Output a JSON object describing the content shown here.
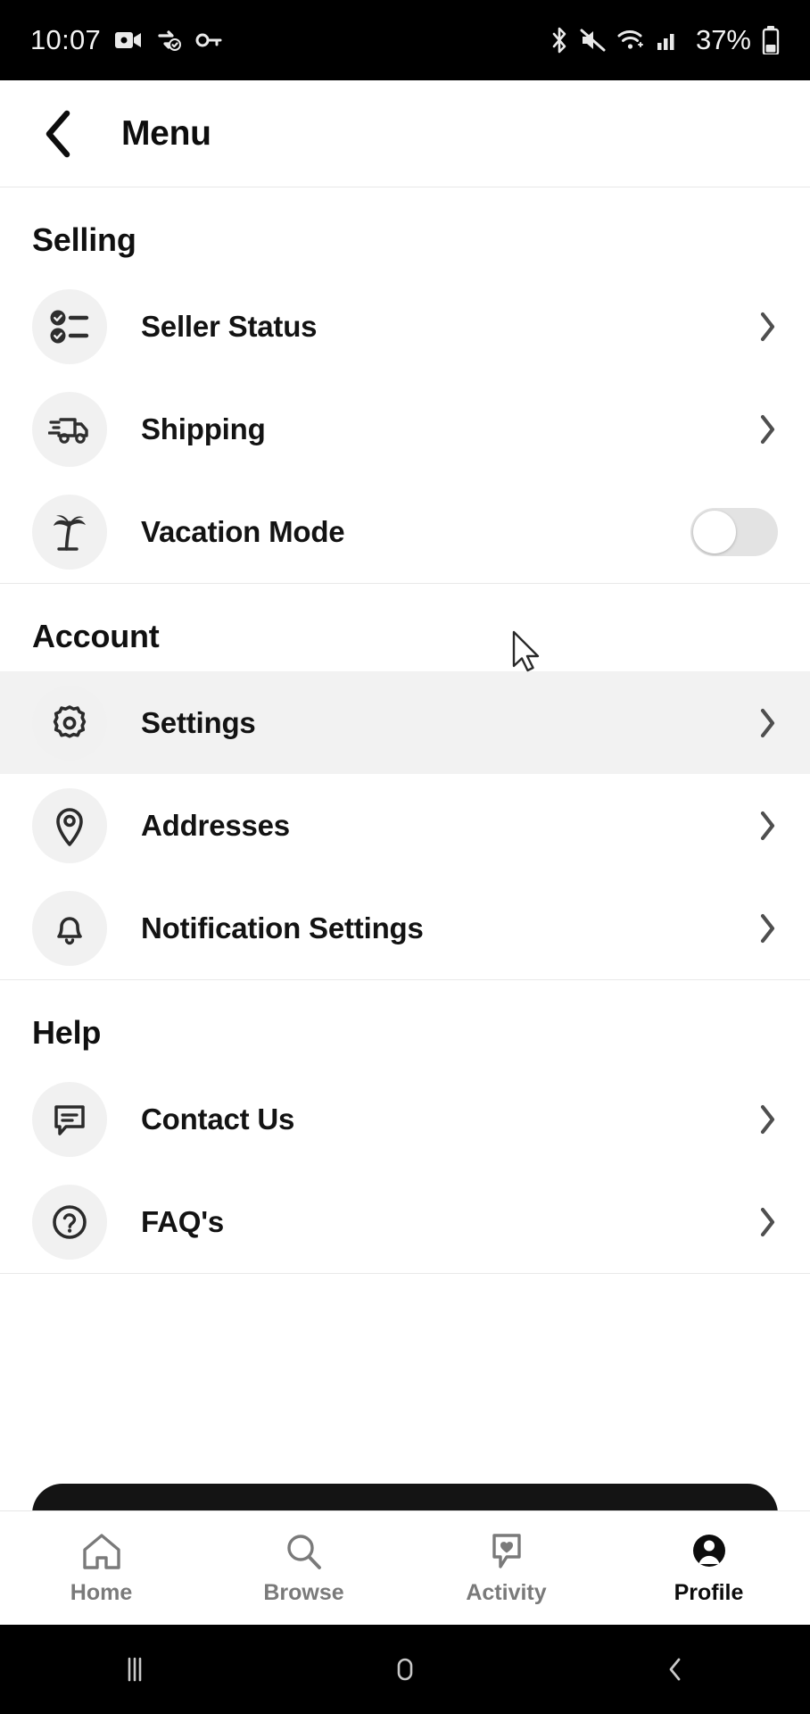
{
  "status_bar": {
    "time": "10:07",
    "battery_percent": "37%",
    "left_icons": [
      "video-camera-icon",
      "data-saver-icon",
      "vpn-key-icon"
    ],
    "right_icons": [
      "bluetooth-icon",
      "mute-icon",
      "wifi-icon",
      "cellular-signal-icon",
      "battery-icon"
    ]
  },
  "header": {
    "back_icon": "back-chevron-icon",
    "title": "Menu"
  },
  "sections": [
    {
      "title": "Selling",
      "items": [
        {
          "label": "Seller Status",
          "icon": "checklist-icon",
          "control": "chevron"
        },
        {
          "label": "Shipping",
          "icon": "truck-icon",
          "control": "chevron"
        },
        {
          "label": "Vacation Mode",
          "icon": "palm-tree-icon",
          "control": "toggle",
          "toggle_on": false
        }
      ]
    },
    {
      "title": "Account",
      "items": [
        {
          "label": "Settings",
          "icon": "gear-icon",
          "control": "chevron",
          "hovered": true
        },
        {
          "label": "Addresses",
          "icon": "location-pin-icon",
          "control": "chevron"
        },
        {
          "label": "Notification Settings",
          "icon": "bell-icon",
          "control": "chevron"
        }
      ]
    },
    {
      "title": "Help",
      "items": [
        {
          "label": "Contact Us",
          "icon": "chat-bubble-icon",
          "control": "chevron"
        },
        {
          "label": "FAQ's",
          "icon": "question-circle-icon",
          "control": "chevron"
        }
      ]
    }
  ],
  "tabbar": {
    "tabs": [
      {
        "label": "Home",
        "icon": "home-icon",
        "active": false
      },
      {
        "label": "Browse",
        "icon": "search-icon",
        "active": false
      },
      {
        "label": "Activity",
        "icon": "heart-bubble-icon",
        "active": false
      },
      {
        "label": "Profile",
        "icon": "person-icon",
        "active": true
      }
    ]
  },
  "android_nav": {
    "recents": "recents-icon",
    "home": "home-circle-icon",
    "back": "back-icon"
  },
  "colors": {
    "background": "#ffffff",
    "text": "#131313",
    "icon_bubble": "#f1f1f1",
    "hover_row": "#f2f2f2",
    "muted": "#7a7a7a",
    "system_bar": "#000000"
  }
}
